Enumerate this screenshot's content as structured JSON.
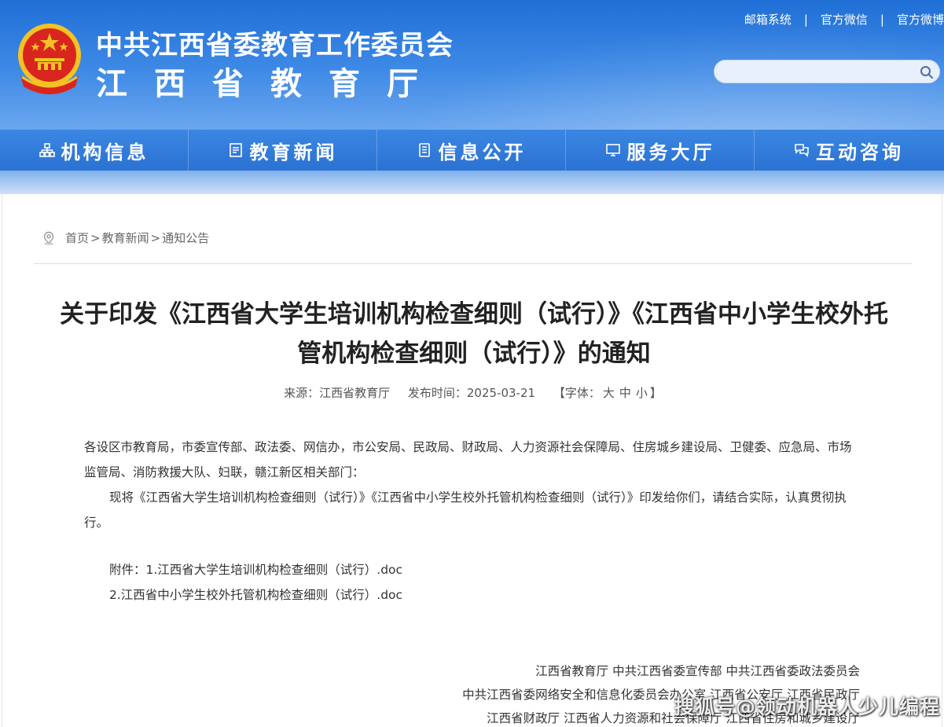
{
  "header": {
    "title_line1": "中共江西省委教育工作委员会",
    "title_line2": "江西省教育厅",
    "links": [
      "邮箱系统",
      "官方微信",
      "官方微博"
    ],
    "search_placeholder": ""
  },
  "nav": {
    "items": [
      {
        "label": "机构信息",
        "icon": "org-chart-icon"
      },
      {
        "label": "教育新闻",
        "icon": "document-icon"
      },
      {
        "label": "信息公开",
        "icon": "file-list-icon"
      },
      {
        "label": "服务大厅",
        "icon": "monitor-icon"
      },
      {
        "label": "互动咨询",
        "icon": "chat-bubbles-icon"
      }
    ]
  },
  "breadcrumb": {
    "home": "首页",
    "sep": ">",
    "level1": "教育新闻",
    "level2": "通知公告"
  },
  "article": {
    "title": "关于印发《江西省大学生培训机构检查细则（试行）》《江西省中小学生校外托管机构检查细则（试行）》的通知",
    "source": "来源：江西省教育厅",
    "date": "发布时间：2025-03-21",
    "font_prefix": "【字体：",
    "font_large": "大",
    "font_medium": "中",
    "font_small": "小",
    "font_suffix": "】",
    "recipients": "各设区市教育局，市委宣传部、政法委、网信办，市公安局、民政局、财政局、人力资源社会保障局、住房城乡建设局、卫健委、应急局、市场监管局、消防救援大队、妇联，赣江新区相关部门：",
    "body": "现将《江西省大学生培训机构检查细则（试行）》《江西省中小学生校外托管机构检查细则（试行）》印发给你们，请结合实际，认真贯彻执行。",
    "attachment_1": "附件：1.江西省大学生培训机构检查细则（试行）.doc",
    "attachment_2": "2.江西省中小学生校外托管机构检查细则（试行）.doc",
    "signers": [
      "江西省教育厅 中共江西省委宣传部 中共江西省委政法委员会",
      "中共江西省委网络安全和信息化委员会办公室 江西省公安厅 江西省民政厅",
      "江西省财政厅 江西省人力资源和社会保障厅 江西省住房和城乡建设厅"
    ]
  },
  "watermark": "搜狐号@领动机器人少儿编程",
  "colors": {
    "header_blue": "#1f6fd6",
    "nav_blue": "#2b72d2",
    "emblem_red": "#d8261e",
    "emblem_gold": "#f5c224"
  }
}
